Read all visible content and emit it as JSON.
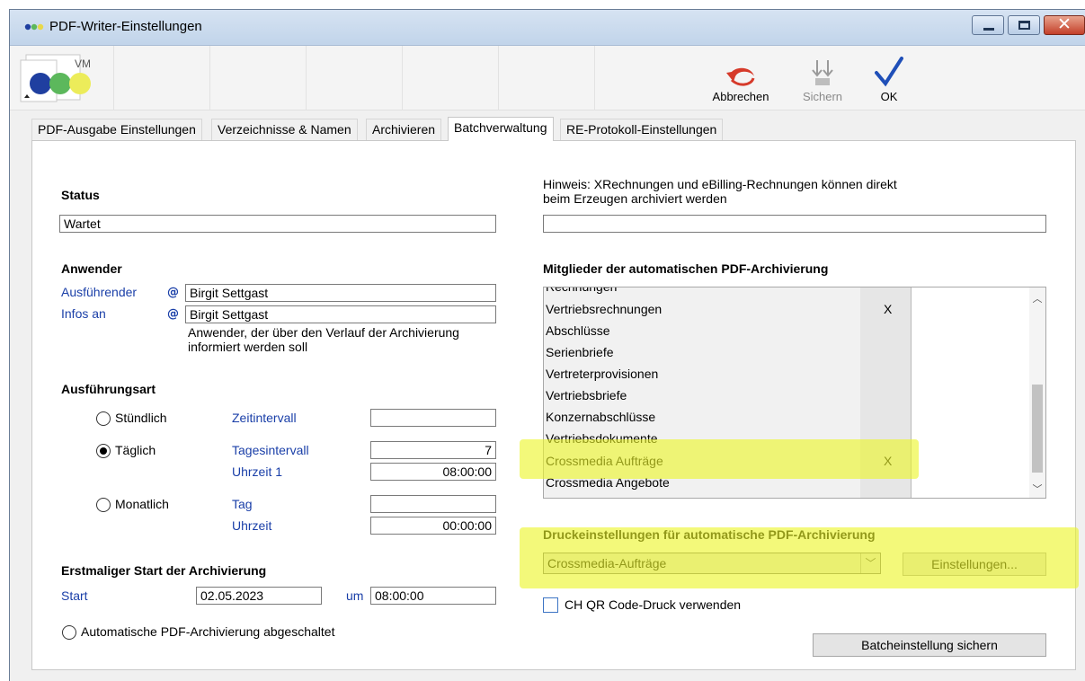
{
  "window": {
    "title": "PDF-Writer-Einstellungen",
    "close_glyph": "✕"
  },
  "toolbar": {
    "logo_text": "VM",
    "cancel_label": "Abbrechen",
    "save_label": "Sichern",
    "ok_label": "OK"
  },
  "tabs": [
    {
      "label": "PDF-Ausgabe Einstellungen"
    },
    {
      "label": "Verzeichnisse & Namen"
    },
    {
      "label": "Archivieren"
    },
    {
      "label": "Batchverwaltung"
    },
    {
      "label": "RE-Protokoll-Einstellungen"
    }
  ],
  "active_tab": "Batchverwaltung",
  "status": {
    "heading": "Status",
    "value": "Wartet"
  },
  "hint": {
    "line1": "Hinweis: XRechnungen und eBilling-Rechnungen können direkt",
    "line2": "beim Erzeugen archiviert werden",
    "value": ""
  },
  "anwender": {
    "heading": "Anwender",
    "executor_label": "Ausführender",
    "executor_value": "Birgit Settgast",
    "info_label": "Infos an",
    "info_value": "Birgit Settgast",
    "note_line1": "Anwender, der über den Verlauf der Archivierung",
    "note_line2": "informiert werden soll",
    "at_symbol": "@"
  },
  "ausfuehrungsart": {
    "heading": "Ausführungsart",
    "hourly": {
      "label": "Stündlich",
      "field_label": "Zeitintervall",
      "value": ""
    },
    "daily": {
      "label": "Täglich",
      "field_label": "Tagesintervall",
      "value": "7",
      "time_label": "Uhrzeit 1",
      "time_value": "08:00:00"
    },
    "monthly": {
      "label": "Monatlich",
      "field_label": "Tag",
      "value": "",
      "time_label": "Uhrzeit",
      "time_value": "00:00:00"
    },
    "selected": "daily"
  },
  "first_start": {
    "heading": "Erstmaliger Start der Archivierung",
    "start_label": "Start",
    "date": "02.05.2023",
    "at_label": "um",
    "time": "08:00:00"
  },
  "disabled_option": {
    "label": "Automatische PDF-Archivierung abgeschaltet",
    "selected": false
  },
  "members": {
    "heading": "Mitglieder der automatischen PDF-Archivierung",
    "rows": [
      {
        "name": "Rechnungen",
        "mark": ""
      },
      {
        "name": "Vertriebsrechnungen",
        "mark": "X"
      },
      {
        "name": "Abschlüsse",
        "mark": ""
      },
      {
        "name": "Serienbriefe",
        "mark": ""
      },
      {
        "name": "Vertreterprovisionen",
        "mark": ""
      },
      {
        "name": "Vertriebsbriefe",
        "mark": ""
      },
      {
        "name": "Konzernabschlüsse",
        "mark": ""
      },
      {
        "name": "Vertriebsdokumente",
        "mark": ""
      },
      {
        "name": "Crossmedia Aufträge",
        "mark": "X"
      },
      {
        "name": "Crossmedia Angebote",
        "mark": ""
      }
    ]
  },
  "print_settings": {
    "heading": "Druckeinstellungen für automatische PDF-Archivierung",
    "selected": "Crossmedia-Aufträge",
    "settings_button": "Einstellungen..."
  },
  "qr_option": {
    "label": "CH QR Code-Druck verwenden",
    "checked": false
  },
  "save_batch_button": "Batcheinstellung sichern",
  "colors": {
    "highlight": "#ebf528",
    "link_blue": "#1a3fa8",
    "ok_check": "#1f4fb8",
    "cancel_arrow": "#d63a2a"
  }
}
